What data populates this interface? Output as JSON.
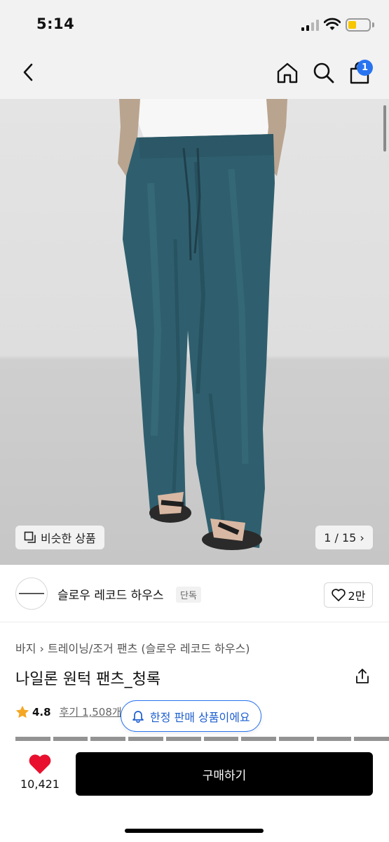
{
  "status_bar": {
    "time": "5:14"
  },
  "nav": {
    "cart_count": "1"
  },
  "gallery": {
    "similar_label": "비슷한 상품",
    "page_indicator": "1 / 15 ›"
  },
  "brand": {
    "name": "슬로우 레코드 하우스",
    "tag": "단독",
    "like_count": "2만"
  },
  "product": {
    "breadcrumb": [
      "바지",
      "트레이닝/조거 팬츠",
      "(슬로우 레코드 하우스)"
    ],
    "breadcrumb_separator": "›",
    "title": "나일론 원턱 팬츠_청록",
    "rating": "4.8",
    "reviews": "후기 1,508개"
  },
  "toast": {
    "label": "한정 판매 상품이에요"
  },
  "bottom": {
    "wish_count": "10,421",
    "buy_label": "구매하기"
  },
  "colors": {
    "accent": "#2874f0",
    "heart": "#e8102e",
    "star": "#f5a623",
    "pants": "#2f5f6e"
  }
}
